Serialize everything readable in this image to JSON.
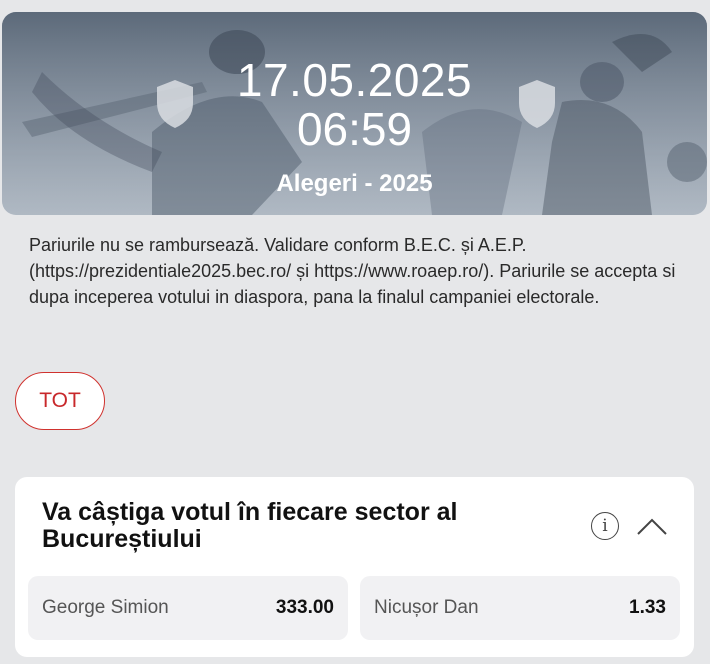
{
  "event_header": {
    "date": "17.05.2025",
    "time": "06:59",
    "event_name": "Alegeri - 2025"
  },
  "notice_text": "Pariurile nu se rambursează. Validare conform B.E.C. și A.E.P. (https://prezidentiale2025.bec.ro/ și https://www.roaep.ro/). Pariurile se accepta si dupa inceperea votului in diaspora, pana la finalul campaniei electorale.",
  "filter_chip": {
    "label": "TOT"
  },
  "market": {
    "title": "Va câștiga votul în fiecare sector al Bucureștiului",
    "info_icon": "info-icon",
    "collapse_icon": "chevron-up-icon",
    "outcomes": [
      {
        "name": "George Simion",
        "odds": "333.00"
      },
      {
        "name": "Nicușor Dan",
        "odds": "1.33"
      }
    ]
  },
  "colors": {
    "accent_red": "#d0322e",
    "page_bg": "#e6e7e9",
    "card_bg": "#ffffff",
    "odd_bg": "#f1f1f3"
  }
}
